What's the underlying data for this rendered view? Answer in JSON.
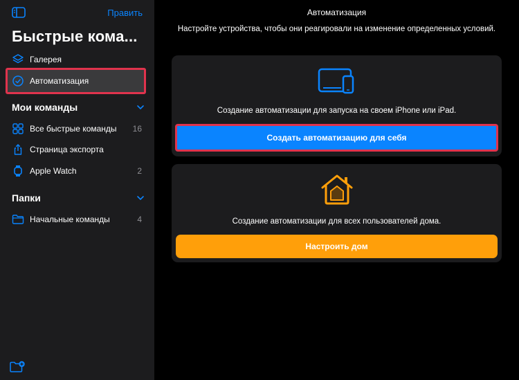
{
  "sidebar": {
    "edit_label": "Править",
    "title": "Быстрые кома...",
    "top_items": [
      {
        "label": "Галерея",
        "icon": "layers-icon"
      },
      {
        "label": "Автоматизация",
        "icon": "clock-check-icon",
        "selected": true
      }
    ],
    "my_commands": {
      "header": "Мои команды",
      "items": [
        {
          "label": "Все быстрые команды",
          "count": "16",
          "icon": "grid-icon"
        },
        {
          "label": "Страница экспорта",
          "count": "",
          "icon": "share-icon"
        },
        {
          "label": "Apple Watch",
          "count": "2",
          "icon": "watch-icon"
        }
      ]
    },
    "folders": {
      "header": "Папки",
      "items": [
        {
          "label": "Начальные команды",
          "count": "4",
          "icon": "folder-icon"
        }
      ]
    }
  },
  "main": {
    "title": "Автоматизация",
    "subtitle": "Настройте устройства, чтобы они реагировали на изменение определенных условий.",
    "personal": {
      "description": "Создание автоматизации для запуска на своем iPhone или iPad.",
      "button_label": "Создать автоматизацию для себя"
    },
    "home": {
      "description": "Создание автоматизации для всех пользователей дома.",
      "button_label": "Настроить дом"
    }
  },
  "colors": {
    "accent_blue": "#0a84ff",
    "accent_orange": "#ff9f0a",
    "highlight_red": "#e0334d"
  }
}
